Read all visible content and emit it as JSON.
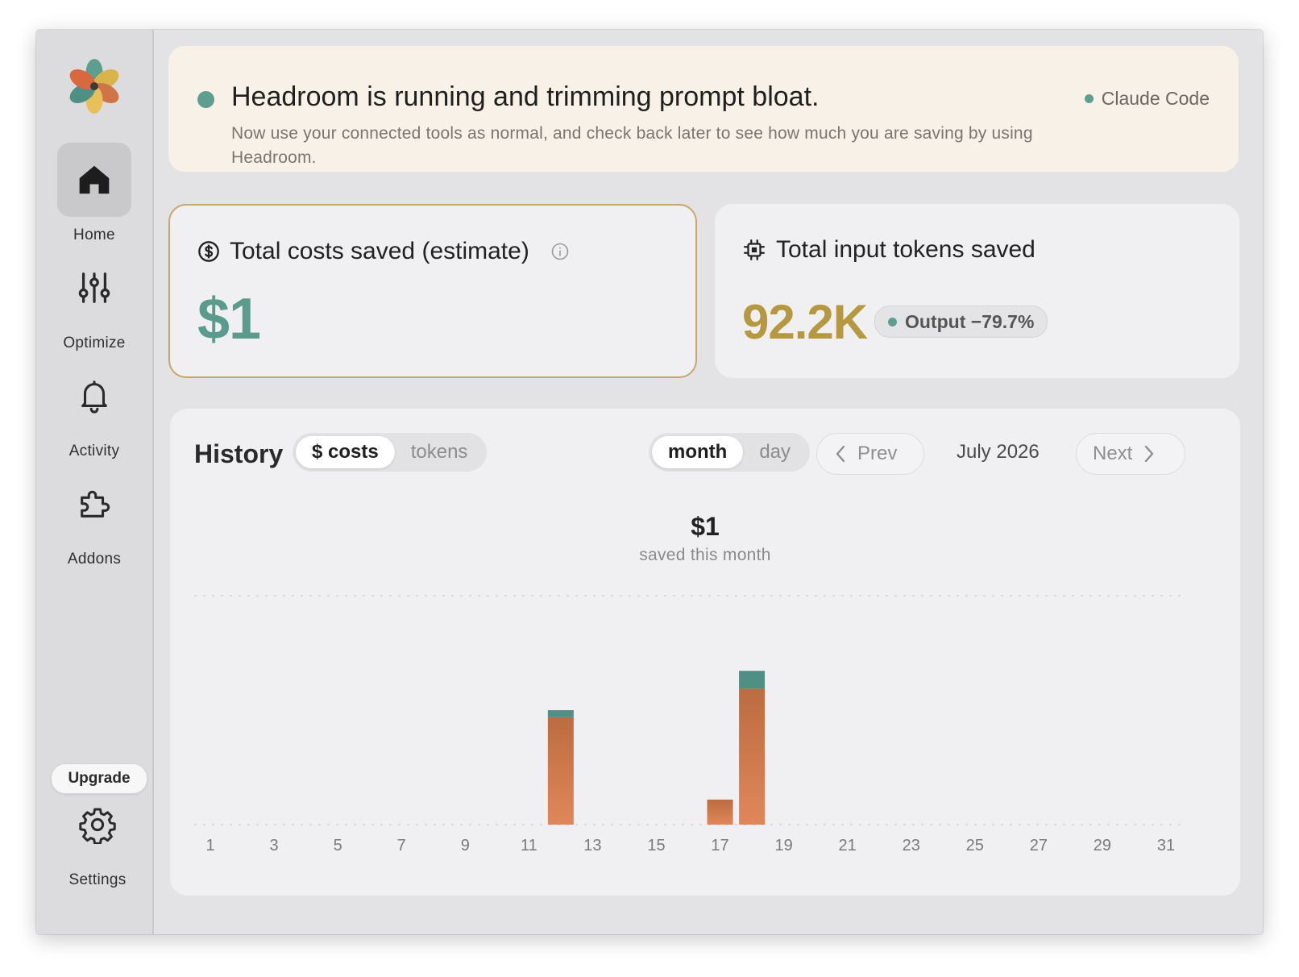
{
  "sidebar": {
    "items": [
      {
        "label": "Home",
        "icon": "home-icon",
        "active": true
      },
      {
        "label": "Optimize",
        "icon": "sliders-icon",
        "active": false
      },
      {
        "label": "Activity",
        "icon": "bell-icon",
        "active": false
      },
      {
        "label": "Addons",
        "icon": "puzzle-icon",
        "active": false
      }
    ],
    "upgrade_label": "Upgrade",
    "settings_label": "Settings"
  },
  "banner": {
    "title": "Headroom is running and trimming prompt bloat.",
    "subtitle": "Now use your connected tools as normal, and check back later to see how much you are saving by using Headroom.",
    "tag": "Claude Code",
    "status_color": "#5e9e8e"
  },
  "cards": {
    "costs": {
      "title": "Total costs saved (estimate)",
      "value": "$1",
      "icon": "dollar-circle-icon",
      "value_color": "#5a9b8d"
    },
    "tokens": {
      "title": "Total input tokens saved",
      "value": "92.2K",
      "icon": "chip-icon",
      "badge": "Output −79.7%",
      "value_color": "#b5983f"
    }
  },
  "history": {
    "title": "History",
    "metric_tabs": [
      "$ costs",
      "tokens"
    ],
    "metric_selected": "$ costs",
    "period_tabs": [
      "month",
      "day"
    ],
    "period_selected": "month",
    "prev_label": "Prev",
    "next_label": "Next",
    "period_label": "July 2026",
    "summary_value": "$1",
    "summary_label": "saved this month"
  },
  "chart_data": {
    "type": "bar",
    "stacked": true,
    "x_tick_labels": [
      "1",
      "3",
      "5",
      "7",
      "9",
      "11",
      "13",
      "15",
      "17",
      "19",
      "21",
      "23",
      "25",
      "27",
      "29",
      "31"
    ],
    "days": [
      1,
      2,
      3,
      4,
      5,
      6,
      7,
      8,
      9,
      10,
      11,
      12,
      13,
      14,
      15,
      16,
      17,
      18,
      19,
      20,
      21,
      22,
      23,
      24,
      25,
      26,
      27,
      28,
      29,
      30,
      31
    ],
    "series": [
      {
        "color": "#cf7447",
        "values": [
          0,
          0,
          0,
          0,
          0,
          0,
          0,
          0,
          0,
          0,
          0,
          0.3,
          0,
          0,
          0,
          0,
          0.07,
          0.38,
          0,
          0,
          0,
          0,
          0,
          0,
          0,
          0,
          0,
          0,
          0,
          0,
          0
        ]
      },
      {
        "color": "#4f8f84",
        "values": [
          0,
          0,
          0,
          0,
          0,
          0,
          0,
          0,
          0,
          0,
          0,
          0.02,
          0,
          0,
          0,
          0,
          0,
          0.05,
          0,
          0,
          0,
          0,
          0,
          0,
          0,
          0,
          0,
          0,
          0,
          0,
          0
        ]
      }
    ],
    "ylim": [
      0,
      0.64
    ],
    "grid": true
  }
}
